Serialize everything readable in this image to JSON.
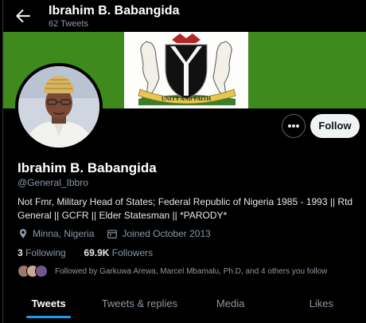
{
  "header": {
    "title": "Ibrahim B. Babangida",
    "tweet_count": "62 Tweets"
  },
  "banner": {
    "color": "#3f8a1c",
    "motto": "UNITY AND FAITH"
  },
  "profile": {
    "name": "Ibrahim B. Babangida",
    "handle": "@General_Ibbro",
    "bio": "Not Fmr, Military Head of States; Federal Republic of Nigeria 1985 - 1993 || Rtd General || GCFR || Elder Statesman || *PARODY*",
    "location": "Minna, Nigeria",
    "joined": "Joined October 2013",
    "following_count": "3",
    "following_label": "Following",
    "followers_count": "69.9K",
    "followers_label": "Followers",
    "followed_by": "Followed by Garkuwa Arewa, Marcel Mbamalu, Ph.D, and 4 others you follow"
  },
  "actions": {
    "follow_label": "Follow",
    "more_icon": "more-icon"
  },
  "tabs": [
    {
      "label": "Tweets",
      "active": true
    },
    {
      "label": "Tweets & replies",
      "active": false
    },
    {
      "label": "Media",
      "active": false
    },
    {
      "label": "Likes",
      "active": false
    }
  ],
  "colors": {
    "accent": "#1d9bf0",
    "background": "#000000",
    "secondary_text": "#8b98a5"
  }
}
